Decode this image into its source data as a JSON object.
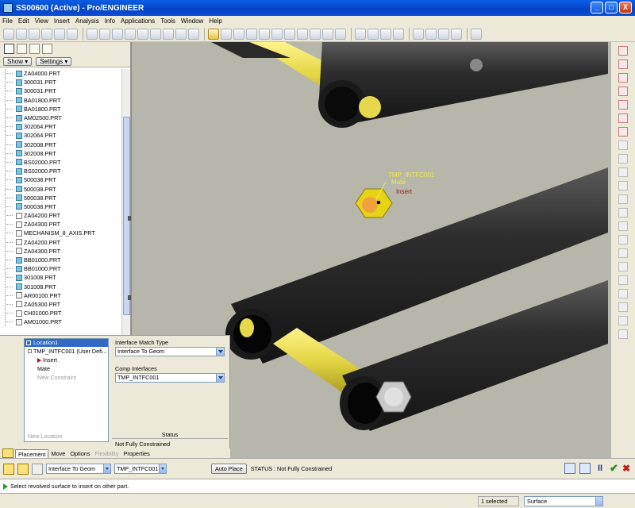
{
  "window": {
    "title": "SS00600 (Active) - Pro/ENGINEER",
    "minimize": "_",
    "maximize": "□",
    "close": "X"
  },
  "menu": [
    "File",
    "Edit",
    "View",
    "Insert",
    "Analysis",
    "Info",
    "Applications",
    "Tools",
    "Window",
    "Help"
  ],
  "model_tree": {
    "show_label": "Show ▾",
    "settings_label": "Settings ▾",
    "items": [
      {
        "label": "ZA04000.PRT",
        "kind": "part"
      },
      {
        "label": "300031.PRT",
        "kind": "part"
      },
      {
        "label": "300031.PRT",
        "kind": "part"
      },
      {
        "label": "BA01800.PRT",
        "kind": "part"
      },
      {
        "label": "BA01800.PRT",
        "kind": "part"
      },
      {
        "label": "AM02500.PRT",
        "kind": "part"
      },
      {
        "label": "302064.PRT",
        "kind": "part"
      },
      {
        "label": "302064.PRT",
        "kind": "part"
      },
      {
        "label": "302008.PRT",
        "kind": "part"
      },
      {
        "label": "302008.PRT",
        "kind": "part"
      },
      {
        "label": "BS02000.PRT",
        "kind": "part"
      },
      {
        "label": "BS02000.PRT",
        "kind": "part"
      },
      {
        "label": "500038.PRT",
        "kind": "part"
      },
      {
        "label": "500038.PRT",
        "kind": "part"
      },
      {
        "label": "500038.PRT",
        "kind": "part"
      },
      {
        "label": "500038.PRT",
        "kind": "part"
      },
      {
        "label": "ZA04200.PRT",
        "kind": "asm"
      },
      {
        "label": "ZA04300.PRT",
        "kind": "asm"
      },
      {
        "label": "MECHANISM_8_AXIS.PRT",
        "kind": "asm"
      },
      {
        "label": "ZA04200.PRT",
        "kind": "asm"
      },
      {
        "label": "ZA04300.PRT",
        "kind": "asm"
      },
      {
        "label": "BB01000.PRT",
        "kind": "part"
      },
      {
        "label": "BB01000.PRT",
        "kind": "part"
      },
      {
        "label": "301008.PRT",
        "kind": "part"
      },
      {
        "label": "301008.PRT",
        "kind": "part"
      },
      {
        "label": "AR00100.PRT",
        "kind": "asm"
      },
      {
        "label": "ZA05300.PRT",
        "kind": "asm"
      },
      {
        "label": "CH01000.PRT",
        "kind": "asm"
      },
      {
        "label": "AM01000.PRT",
        "kind": "asm"
      }
    ]
  },
  "viewport": {
    "callout_name": "TMP_INTFC001",
    "callout_mate": "Mate",
    "callout_insert": "Insert",
    "colors": {
      "background": "#b6b6ab",
      "tube": "#2a2a2a",
      "rod": "#e5d84a",
      "callout": "#f2e94a",
      "insert_label": "#a01818"
    }
  },
  "placement_panel": {
    "set_label": "Location1",
    "interface_item": "TMP_INTFC001 (User Defi...",
    "constraints": [
      "Insert",
      "Mate"
    ],
    "new_constraint": "New Constraint",
    "new_location": "New Location",
    "match_type_label": "Interface Match Type",
    "match_type_value": "Interface To Geom",
    "comp_interfaces_label": "Comp Interfaces",
    "comp_interfaces_value": "TMP_INTFC001",
    "status_title": "Status",
    "status_value": "Not Fully Constrained"
  },
  "dashboard_tabs": [
    {
      "label": "Placement",
      "state": "active"
    },
    {
      "label": "Move",
      "state": "normal"
    },
    {
      "label": "Options",
      "state": "normal"
    },
    {
      "label": "Flexibility",
      "state": "disabled"
    },
    {
      "label": "Properties",
      "state": "normal"
    }
  ],
  "dashboard": {
    "match_select": "Interface To Geom",
    "interface_select": "TMP_INTFC001",
    "auto_place": "Auto Place",
    "status_text": "STATUS : Not Fully Constrained",
    "pause": "II",
    "ok": "✔",
    "cancel": "✖"
  },
  "message": "Select revolved surface to insert on other part.",
  "statusbar": {
    "selected": "1 selected",
    "filter": "Surface"
  }
}
